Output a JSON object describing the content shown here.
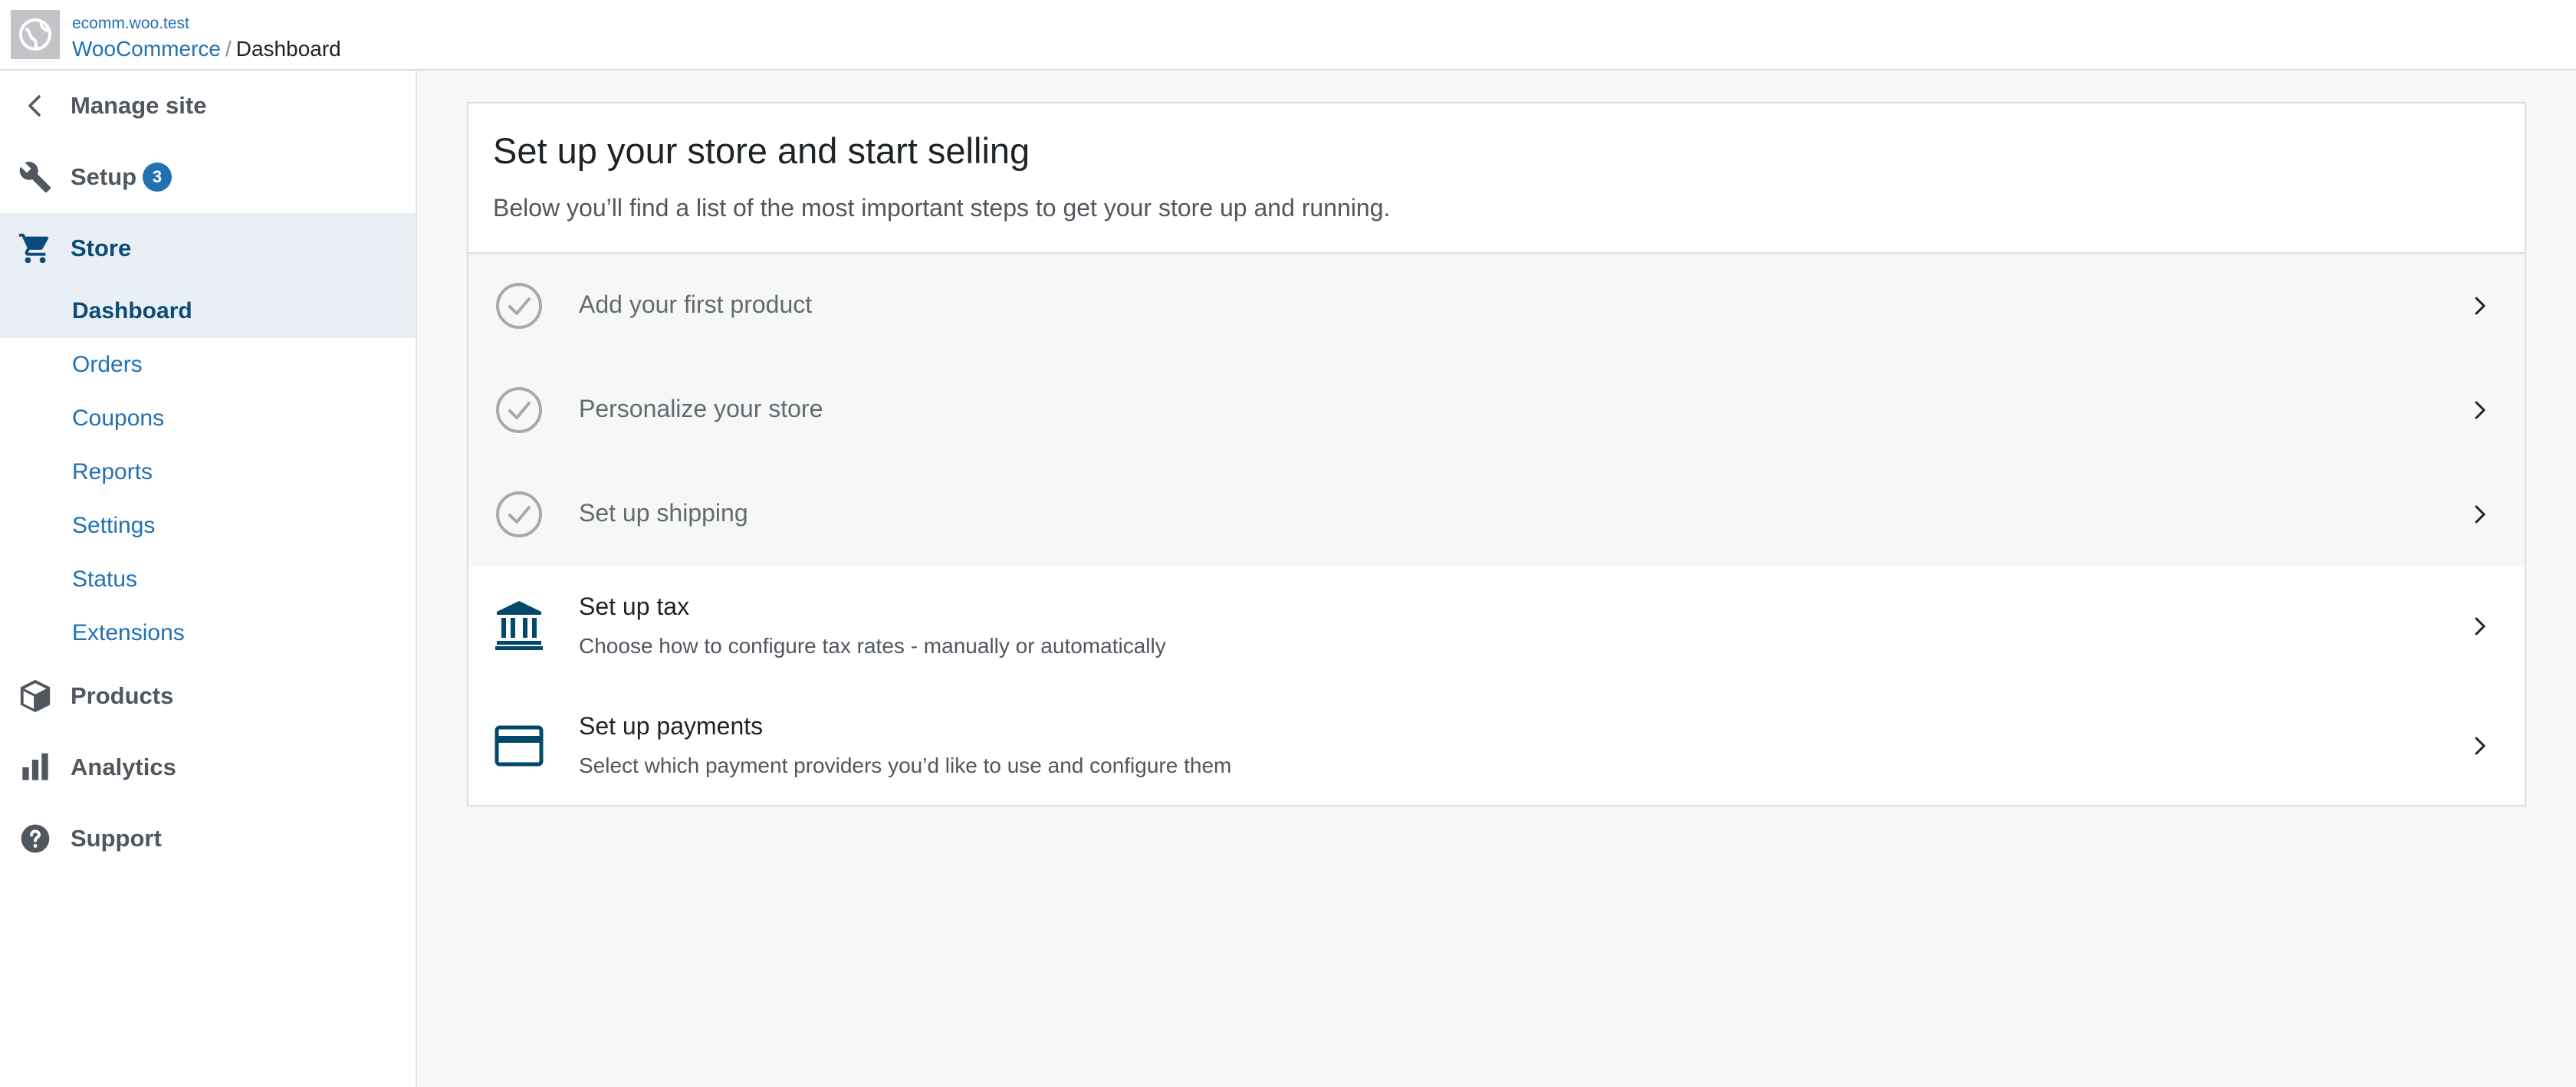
{
  "topbar": {
    "site_domain": "ecomm.woo.test",
    "breadcrumb_parent": "WooCommerce",
    "breadcrumb_separator": "/",
    "breadcrumb_current": "Dashboard"
  },
  "sidebar": {
    "manage_site": "Manage site",
    "setup": {
      "label": "Setup",
      "badge": "3"
    },
    "store": {
      "label": "Store",
      "items": [
        "Dashboard",
        "Orders",
        "Coupons",
        "Reports",
        "Settings",
        "Status",
        "Extensions"
      ]
    },
    "products": "Products",
    "analytics": "Analytics",
    "support": "Support"
  },
  "card": {
    "title": "Set up your store and start selling",
    "description": "Below you’ll find a list of the most important steps to get your store up and running.",
    "tasks": [
      {
        "title": "Add your first product",
        "completed": true,
        "icon": "check-circle-icon"
      },
      {
        "title": "Personalize your store",
        "completed": true,
        "icon": "check-circle-icon"
      },
      {
        "title": "Set up shipping",
        "completed": true,
        "icon": "check-circle-icon"
      },
      {
        "title": "Set up tax",
        "subtitle": "Choose how to configure tax rates - manually or automatically",
        "completed": false,
        "icon": "bank-icon"
      },
      {
        "title": "Set up payments",
        "subtitle": "Select which payment providers you’d like to use and configure them",
        "completed": false,
        "icon": "credit-card-icon"
      }
    ]
  },
  "colors": {
    "accent": "#2271b1",
    "accent_dark": "#0a4b78",
    "completed_gray": "#a7aaad",
    "icon_dark": "#00496b"
  }
}
